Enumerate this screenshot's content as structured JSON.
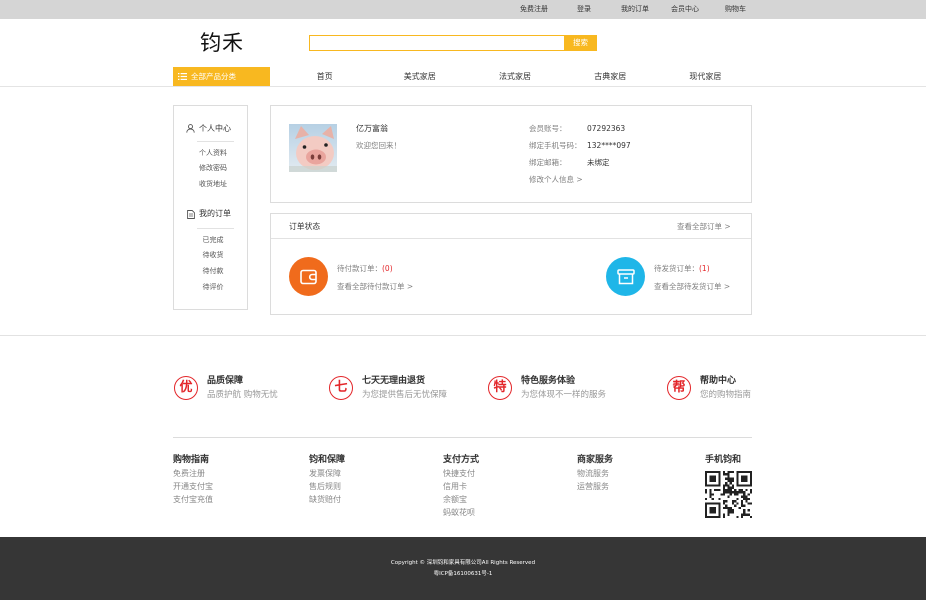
{
  "topbar": {
    "links": [
      "免费注册",
      "登录",
      "我的订单",
      "会员中心",
      "购物车"
    ]
  },
  "header": {
    "logo": "钧禾",
    "search_button": "搜索"
  },
  "nav": {
    "category_label": "全部产品分类",
    "category_icon": "list-icon",
    "items": [
      "首页",
      "美式家居",
      "法式家居",
      "古典家居",
      "现代家居"
    ]
  },
  "sidebar": {
    "sections": [
      {
        "title": "个人中心",
        "icon": "user-icon",
        "items": [
          "个人资料",
          "修改密码",
          "收货地址"
        ]
      },
      {
        "title": "我的订单",
        "icon": "document-icon",
        "items": [
          "已完成",
          "待收货",
          "待付款",
          "待评价"
        ]
      }
    ]
  },
  "profile": {
    "username": "亿万富翁",
    "welcome": "欢迎您回来！",
    "fields": [
      {
        "label": "会员账号：",
        "value": "07292363"
      },
      {
        "label": "绑定手机号码：",
        "value": "132****097"
      },
      {
        "label": "绑定邮箱：",
        "value": "未绑定"
      }
    ],
    "edit_link": "修改个人信息 >"
  },
  "orders": {
    "title": "订单状态",
    "view_all": "查看全部订单 >",
    "items": [
      {
        "label": "待付款订单：",
        "count": "(0)",
        "link": "查看全部待付款订单 >",
        "icon": "wallet-icon",
        "color": "#f06b1c"
      },
      {
        "label": "待发货订单：",
        "count": "(1)",
        "link": "查看全部待发货订单 >",
        "icon": "box-icon",
        "color": "#1fb6e8"
      }
    ]
  },
  "services": [
    {
      "glyph": "优",
      "title": "品质保障",
      "subtitle": "品质护航 购物无忧"
    },
    {
      "glyph": "七",
      "title": "七天无理由退货",
      "subtitle": "为您提供售后无忧保障"
    },
    {
      "glyph": "特",
      "title": "特色服务体验",
      "subtitle": "为您体现不一样的服务"
    },
    {
      "glyph": "帮",
      "title": "帮助中心",
      "subtitle": "您的购物指南"
    }
  ],
  "footer_columns": [
    {
      "title": "购物指南",
      "items": [
        "免费注册",
        "开通支付宝",
        "支付宝充值"
      ]
    },
    {
      "title": "钧和保障",
      "items": [
        "发票保障",
        "售后规则",
        "缺货赔付"
      ]
    },
    {
      "title": "支付方式",
      "items": [
        "快捷支付",
        "信用卡",
        "余额宝",
        "蚂蚁花呗"
      ]
    },
    {
      "title": "商家服务",
      "items": [
        "物流服务",
        "运营服务"
      ]
    }
  ],
  "mobile": {
    "title": "手机钧和",
    "icon": "qr-code-icon"
  },
  "copyright": {
    "line1": "Copyright © 深圳钧和家具有限公司All Rights Reserved",
    "line2": "粤ICP备16100631号-1"
  },
  "colors": {
    "accent": "#f8b820",
    "orange": "#f06b1c",
    "cyan": "#1fb6e8",
    "red": "#e3262a",
    "footer_bg": "#363636",
    "topbar_bg": "#d5d5d5"
  }
}
